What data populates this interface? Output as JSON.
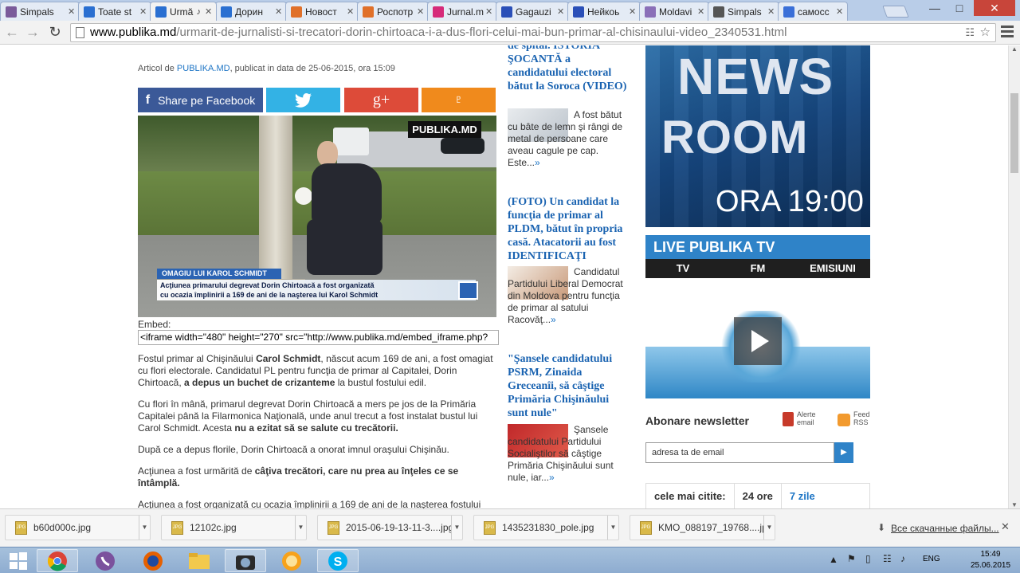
{
  "browser": {
    "tabs": [
      {
        "label": "Simpals",
        "icon_color": "#7a5a9a",
        "active": false
      },
      {
        "label": "Toate st",
        "icon_color": "#2a6fd1",
        "active": false
      },
      {
        "label": "Urmă",
        "icon_color": "#2a6fd1",
        "active": true
      },
      {
        "label": "Дорин",
        "icon_color": "#2a6fd1",
        "active": false
      },
      {
        "label": "Новост",
        "icon_color": "#e0702a",
        "active": false
      },
      {
        "label": "Роспотр",
        "icon_color": "#e0702a",
        "active": false
      },
      {
        "label": "Jurnal.m",
        "icon_color": "#d62a7a",
        "active": false
      },
      {
        "label": "Gagauzi",
        "icon_color": "#2a4fb8",
        "active": false
      },
      {
        "label": "Нейкоь",
        "icon_color": "#2a4fb8",
        "active": false
      },
      {
        "label": "Moldavi",
        "icon_color": "#8a6fb8",
        "active": false
      },
      {
        "label": "Simpals",
        "icon_color": "#555555",
        "active": false
      },
      {
        "label": "самосс",
        "icon_color": "#3a6fd8",
        "active": false
      }
    ],
    "url_domain": "www.publika.md",
    "url_path": "/urmarit-de-jurnalisti-si-trecatori-dorin-chirtoaca-i-a-dus-flori-celui-mai-bun-primar-al-chisinaului-video_2340531.html"
  },
  "article": {
    "meta_prefix": "Articol de ",
    "meta_author": "PUBLIKA.MD",
    "meta_suffix": ", publicat in data de 25-06-2015, ora 15:09",
    "share_facebook": "Share pe Facebook",
    "video_logo": "PUBLIKA.MD",
    "video_caption_title": "OMAGIU LUI KAROL SCHMIDT",
    "video_caption_line1": "Acţiunea primarului degrevat Dorin Chirtoacă a fost organizată",
    "video_caption_line2": "cu ocazia împlinirii a 169 de ani de la naşterea lui Karol Schmidt",
    "embed_label": "Embed:",
    "embed_code": "<iframe width=\"480\" height=\"270\" src=\"http://www.publika.md/embed_iframe.php?",
    "p1_a": "Fostul primar al Chişinăului ",
    "p1_b": "Carol Schmidt",
    "p1_c": ", născut acum 169 de ani, a fost omagiat cu flori electorale. Candidatul PL pentru funcţia de primar al Capitalei, Dorin Chirtoacă, ",
    "p1_d": "a depus un buchet de crizanteme",
    "p1_e": " la bustul fostului edil.",
    "p2_a": "Cu flori în mână, primarul degrevat Dorin Chirtoacă a mers pe jos de la Primăria Capitalei până la Filarmonica Naţională, unde anul trecut a fost instalat bustul lui Carol Schmidt. Acesta ",
    "p2_b": "nu a ezitat să se salute cu trecătorii.",
    "p3": "După ce a depus florile, Dorin Chirtoacă a onorat imnul oraşului Chişinău.",
    "p4_a": "Acţiunea a fost urmărită de ",
    "p4_b": "câţiva trecători, care nu prea au înţeles ce se întâmplă.",
    "p5": "Acţiunea a fost organizată cu ocazia împlinirii a 169 de ani de la naşterea fostului"
  },
  "sidebar": {
    "s1_title": "de spital. ISTORIA ŞOCANTĂ a candidatului electoral bătut la Soroca (VIDEO)",
    "s1_text": "A fost bătut cu bâte de lemn şi rângi de metal de persoane care aveau cagule pe cap. Este...",
    "s2_title": "(FOTO) Un candidat la funcţia de primar al PLDM, bătut în propria casă. Atacatorii au fost IDENTIFICAŢI",
    "s2_text": "Candidatul Partidului Liberal Democrat din Moldova pentru funcţia de primar al satului Racovăţ...",
    "s3_title": "\"Şansele candidatului PSRM, Zinaida Greceanîi, să câştige Primăria Chişinăului sunt nule\"",
    "s3_text": "Şansele candidatului Partidului Socialiştilor să câştige Primăria Chişinăului sunt nule, iar...",
    "more_glyph": "»"
  },
  "right": {
    "news_line1": "NEWS",
    "news_line2": "ROOM",
    "news_time": "ORA 19:00",
    "live_title": "LIVE PUBLIKA TV",
    "live_tabs": [
      "TV",
      "FM",
      "EMISIUNI"
    ],
    "newsletter_title": "Abonare newsletter",
    "alerte_label1": "Alerte",
    "alerte_label2": "email",
    "feed_label1": "Feed",
    "feed_label2": "RSS",
    "email_placeholder": "adresa ta de email",
    "cele_label": "cele mai citite:",
    "cele_tab1": "24 ore",
    "cele_tab2": "7 zile"
  },
  "downloads": {
    "files": [
      "b60d000c.jpg",
      "12102c.jpg",
      "2015-06-19-13-11-3....jpg",
      "1435231830_pole.jpg",
      "KMO_088197_19768....jpg"
    ],
    "show_all": "Все скачанные файлы..."
  },
  "taskbar": {
    "lang": "ENG",
    "time": "15:49",
    "date": "25.06.2015"
  }
}
